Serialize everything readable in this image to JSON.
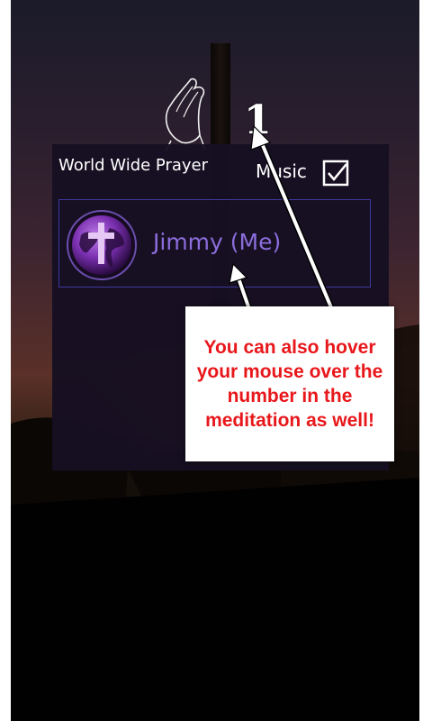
{
  "app": {
    "title": "World Wide Prayer"
  },
  "music": {
    "label": "Music",
    "checked": true
  },
  "user": {
    "name": "Jimmy (Me)",
    "avatar_icon": "globe-cross-icon"
  },
  "meditation": {
    "count": "1"
  },
  "tooltip": {
    "text": "You can also hover your mouse over the number in the meditation as well!"
  },
  "colors": {
    "panel_bg": "#16102a",
    "user_name": "#8c6ddd",
    "row_border": "#3c3aa0",
    "tooltip_text": "#e8171b",
    "tooltip_bg": "#ffffff"
  }
}
